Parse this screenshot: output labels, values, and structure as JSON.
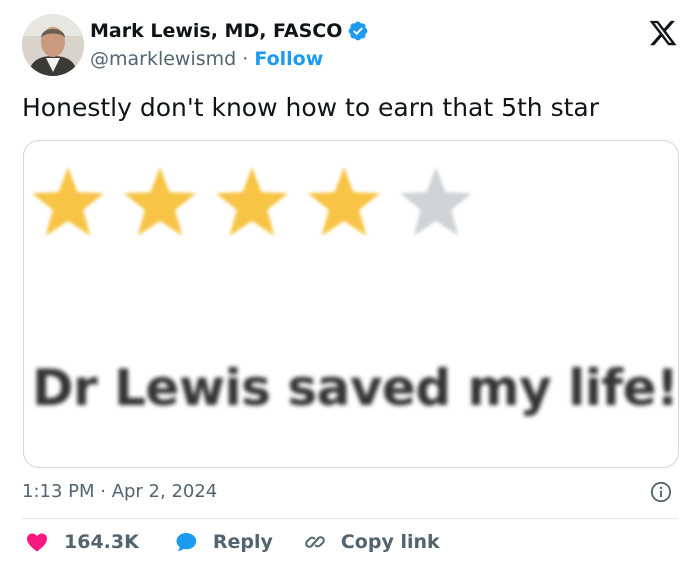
{
  "author": {
    "display_name": "Mark Lewis, MD, FASCO",
    "handle": "@marklewismd",
    "separator": "·",
    "follow_label": "Follow",
    "verified": true,
    "verified_color": "#1d9bf0"
  },
  "brand_logo": "x-logo-icon",
  "tweet": {
    "text": "Honestly don't know how to earn that 5th star"
  },
  "media": {
    "rating": {
      "value": 4,
      "max": 5,
      "filled_color": "#f8c445",
      "empty_color": "#cfd3d6"
    },
    "review_text": "Dr Lewis saved my life!"
  },
  "meta": {
    "timestamp": "1:13 PM · Apr 2, 2024",
    "info_icon": "info-icon"
  },
  "actions": {
    "likes": "164.3K",
    "like_icon": "heart-icon",
    "like_color": "#f91880",
    "reply_label": "Reply",
    "reply_icon": "chat-bubble-icon",
    "reply_color": "#1d9bf0",
    "copy_label": "Copy link",
    "copy_icon": "link-icon"
  }
}
